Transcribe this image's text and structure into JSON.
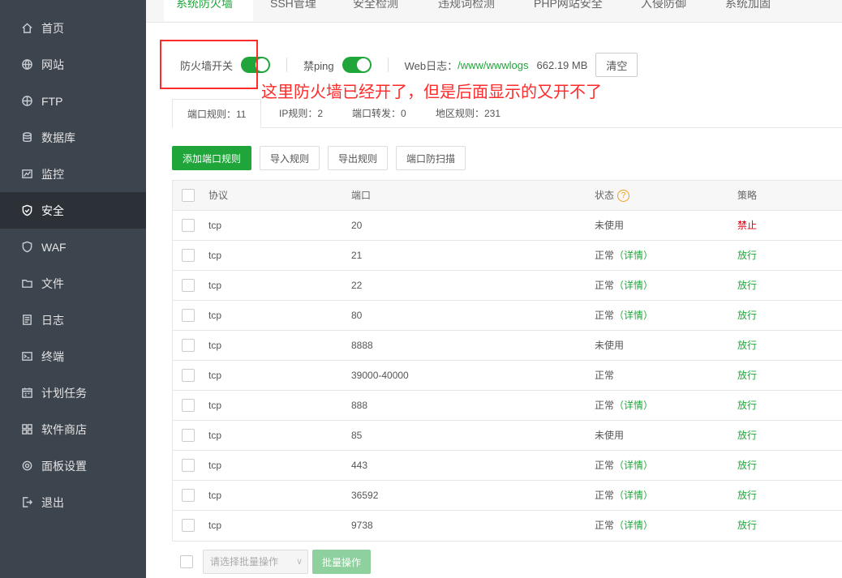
{
  "sidebar": {
    "items": [
      {
        "label": "首页",
        "icon": "home-icon"
      },
      {
        "label": "网站",
        "icon": "globe-icon"
      },
      {
        "label": "FTP",
        "icon": "ftp-icon"
      },
      {
        "label": "数据库",
        "icon": "database-icon"
      },
      {
        "label": "监控",
        "icon": "monitor-icon"
      },
      {
        "label": "安全",
        "icon": "shield-icon",
        "active": true
      },
      {
        "label": "WAF",
        "icon": "waf-icon"
      },
      {
        "label": "文件",
        "icon": "folder-icon"
      },
      {
        "label": "日志",
        "icon": "log-icon"
      },
      {
        "label": "终端",
        "icon": "terminal-icon"
      },
      {
        "label": "计划任务",
        "icon": "calendar-icon"
      },
      {
        "label": "软件商店",
        "icon": "apps-icon"
      },
      {
        "label": "面板设置",
        "icon": "settings-icon"
      },
      {
        "label": "退出",
        "icon": "logout-icon"
      }
    ]
  },
  "top_tabs": [
    "系统防火墙",
    "SSH管理",
    "安全检测",
    "违规词检测",
    "PHP网站安全",
    "入侵防御",
    "系统加固"
  ],
  "toolbar": {
    "firewall_label": "防火墙开关",
    "ping_label": "禁ping",
    "log_label": "Web日志：",
    "log_path": "/www/wwwlogs",
    "log_size": "662.19 MB",
    "clear_label": "清空"
  },
  "annotation": "这里防火墙已经开了，但是后面显示的又开不了",
  "sub_tabs": [
    "端口规则：11",
    "IP规则：2",
    "端口转发：0",
    "地区规则：231"
  ],
  "actions": [
    "添加端口规则",
    "导入规则",
    "导出规则",
    "端口防扫描"
  ],
  "table": {
    "headers": {
      "protocol": "协议",
      "port": "端口",
      "status": "状态",
      "policy": "策略"
    },
    "rows": [
      {
        "protocol": "tcp",
        "port": "20",
        "status": "未使用",
        "detail": "",
        "policy": "禁止"
      },
      {
        "protocol": "tcp",
        "port": "21",
        "status": "正常",
        "detail": "（详情）",
        "policy": "放行"
      },
      {
        "protocol": "tcp",
        "port": "22",
        "status": "正常",
        "detail": "（详情）",
        "policy": "放行"
      },
      {
        "protocol": "tcp",
        "port": "80",
        "status": "正常",
        "detail": "（详情）",
        "policy": "放行"
      },
      {
        "protocol": "tcp",
        "port": "8888",
        "status": "未使用",
        "detail": "",
        "policy": "放行"
      },
      {
        "protocol": "tcp",
        "port": "39000-40000",
        "status": "正常",
        "detail": "",
        "policy": "放行"
      },
      {
        "protocol": "tcp",
        "port": "888",
        "status": "正常",
        "detail": "（详情）",
        "policy": "放行"
      },
      {
        "protocol": "tcp",
        "port": "85",
        "status": "未使用",
        "detail": "",
        "policy": "放行"
      },
      {
        "protocol": "tcp",
        "port": "443",
        "status": "正常",
        "detail": "（详情）",
        "policy": "放行"
      },
      {
        "protocol": "tcp",
        "port": "36592",
        "status": "正常",
        "detail": "（详情）",
        "policy": "放行"
      },
      {
        "protocol": "tcp",
        "port": "9738",
        "status": "正常",
        "detail": "（详情）",
        "policy": "放行"
      }
    ]
  },
  "footer": {
    "select_placeholder": "请选择批量操作",
    "batch_label": "批量操作"
  },
  "colors": {
    "accent": "#20a53a",
    "deny": "#d9000d",
    "annotation": "#ff2a2a",
    "sidebar": "#3c444d"
  }
}
